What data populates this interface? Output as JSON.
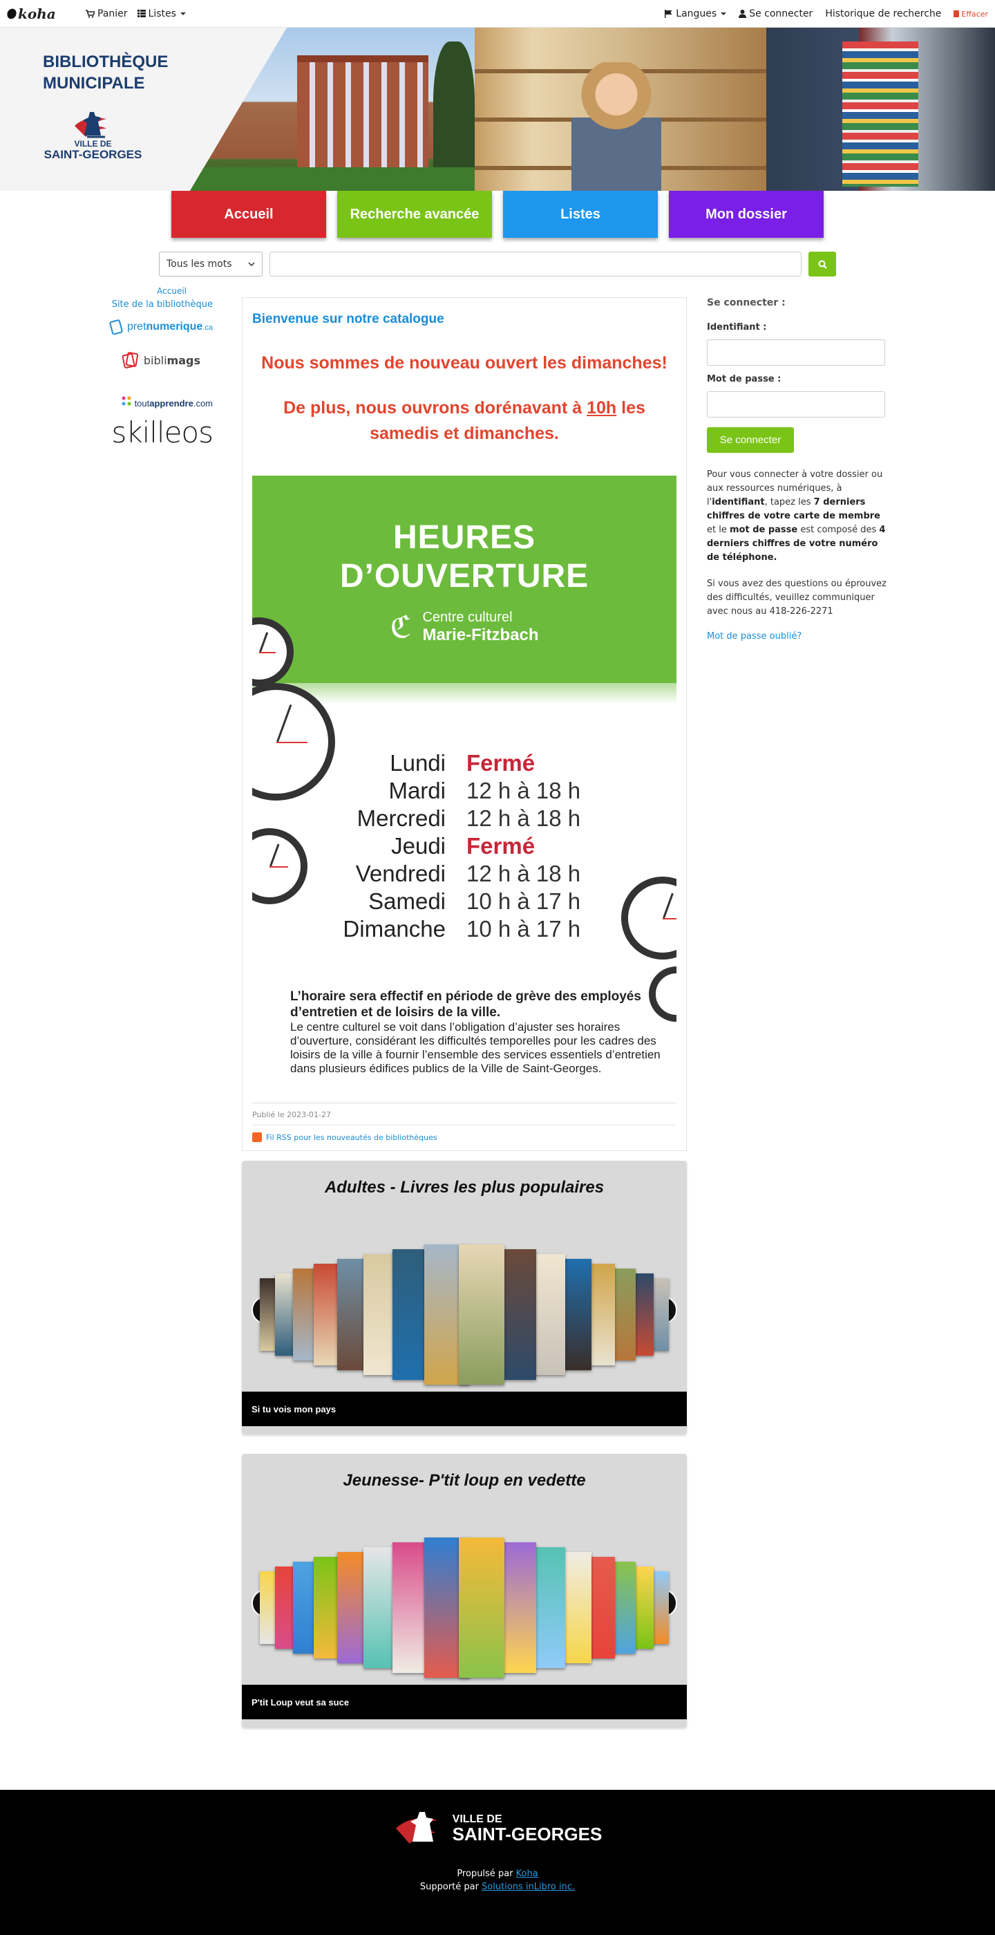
{
  "topbar": {
    "logo": "koha",
    "cart": "Panier",
    "lists": "Listes",
    "languages": "Langues",
    "login": "Se connecter",
    "history": "Historique de recherche",
    "clear": "Effacer"
  },
  "banner": {
    "title_line1": "BIBLIOTHÈQUE",
    "title_line2": "MUNICIPALE",
    "city_small": "VILLE DE",
    "city_big": "SAINT-GEORGES"
  },
  "menu": [
    {
      "label": "Accueil",
      "color": "#d7282f"
    },
    {
      "label": "Recherche avancée",
      "color": "#7ac417"
    },
    {
      "label": "Listes",
      "color": "#1e97ee"
    },
    {
      "label": "Mon dossier",
      "color": "#7a1fe6"
    }
  ],
  "search": {
    "scope": "Tous les mots",
    "placeholder": ""
  },
  "sidebar": {
    "breadcrumb": "Accueil",
    "library_site": "Site de la bibliothèque",
    "partners": {
      "pretnumerique_a": "pret",
      "pretnumerique_b": "numerique",
      "pretnumerique_c": ".ca",
      "biblimags_a": "bibli",
      "biblimags_b": "mags",
      "toutapprendre_a": "tout",
      "toutapprendre_b": "apprendre",
      "toutapprendre_c": ".com",
      "skilleos": "skilleos"
    }
  },
  "news": {
    "title": "Bienvenue sur notre catalogue",
    "msg1": "Nous sommes de nouveau ouvert les dimanches!",
    "msg2_a": "De plus, nous ouvrons dorénavant à ",
    "msg2_u": "10h",
    "msg2_b": " les samedis et dimanches.",
    "poster": {
      "heading1": "HEURES",
      "heading2": "D’OUVERTURE",
      "centre1": "Centre culturel",
      "centre2": "Marie-Fitzbach",
      "hours": [
        {
          "day": "Lundi",
          "value": "Fermé",
          "closed": true
        },
        {
          "day": "Mardi",
          "value": "12 h à 18 h",
          "closed": false
        },
        {
          "day": "Mercredi",
          "value": "12 h à 18 h",
          "closed": false
        },
        {
          "day": "Jeudi",
          "value": "Fermé",
          "closed": true
        },
        {
          "day": "Vendredi",
          "value": "12 h à 18 h",
          "closed": false
        },
        {
          "day": "Samedi",
          "value": "10 h à 17 h",
          "closed": false
        },
        {
          "day": "Dimanche",
          "value": "10 h à 17 h",
          "closed": false
        }
      ],
      "note_bold": "L’horaire sera effectif en période de grève des employés d’entretien et de loisirs de la ville.",
      "note": "Le centre culturel se voit dans l’obligation d’ajuster ses horaires d’ouverture, considérant les difficultés temporelles pour les cadres des loisirs de la ville à fournir l’ensemble des services essentiels d’entretien dans plusieurs édifices publics de la Ville de Saint-Georges."
    },
    "published": "Publié le 2023-01-27",
    "rss": "Fil RSS pour les nouveautés de bibliothèques"
  },
  "carousels": [
    {
      "title": "Adultes - Livres les plus populaires",
      "caption": "Si tu vois mon pays",
      "prev": "❮",
      "next": "❯"
    },
    {
      "title": "Jeunesse- P'tit loup en vedette",
      "caption": "P'tit Loup veut sa suce",
      "prev": "❮",
      "next": "❯"
    }
  ],
  "login": {
    "heading": "Se connecter :",
    "user_label": "Identifiant :",
    "pass_label": "Mot de passe :",
    "button": "Se connecter",
    "help_1": "Pour vous connecter à votre dossier ou aux ressources numériques, à l'",
    "help_b1": "identifiant",
    "help_2": ", tapez les ",
    "help_b2": "7 derniers chiffres de votre carte de membre",
    "help_3": " et le ",
    "help_b3": "mot de passe",
    "help_4": " est composé des ",
    "help_b4": "4 derniers chiffres de votre numéro de téléphone.",
    "question": "Si vous avez des questions ou éprouvez des difficultés, veuillez communiquer avec nous au 418-226-2271",
    "forgot": "Mot de passe oublié?"
  },
  "footer": {
    "city_small": "VILLE DE",
    "city_big": "SAINT-GEORGES",
    "powered_a": "Propulsé par ",
    "powered_link": "Koha",
    "support_a": "Supporté par ",
    "support_link": "Solutions inLibro inc."
  }
}
